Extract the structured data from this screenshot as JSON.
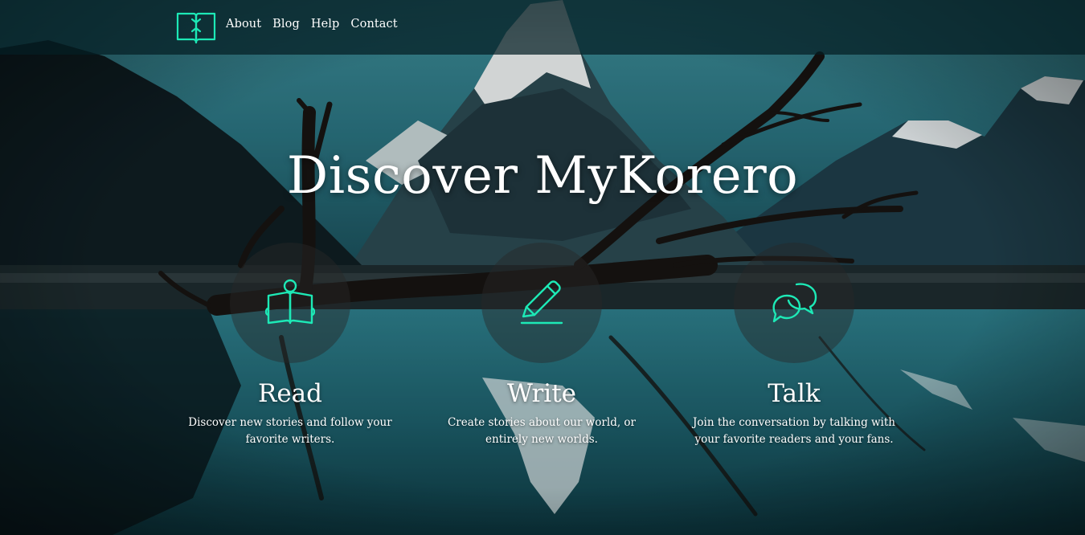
{
  "nav": {
    "logo_icon": "book-arrows-icon",
    "links": [
      "About",
      "Blog",
      "Help",
      "Contact"
    ]
  },
  "hero": {
    "title": "Discover MyKorero"
  },
  "features": [
    {
      "icon": "reading-book-icon",
      "heading": "Read",
      "text": "Discover new stories and follow your favorite writers."
    },
    {
      "icon": "pencil-icon",
      "heading": "Write",
      "text": "Create stories about our world, or entirely new worlds."
    },
    {
      "icon": "chat-bubbles-icon",
      "heading": "Talk",
      "text": "Join the conversation by talking with your favorite readers and your fans."
    }
  ],
  "colors": {
    "accent": "#1de9b6",
    "navbar_bg": "#041e24",
    "text": "#ffffff"
  }
}
